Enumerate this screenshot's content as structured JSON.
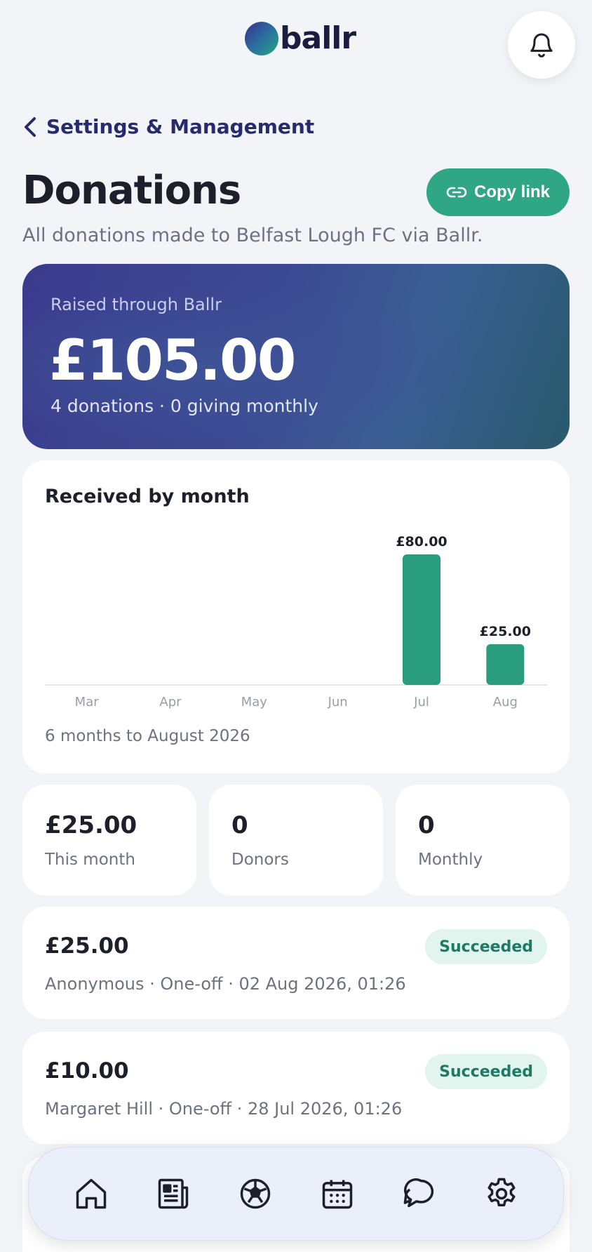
{
  "header": {
    "logo_text": "ballr",
    "logo_icon": "ballr-logo-mark",
    "bell_icon": "bell-icon"
  },
  "back": {
    "label": "Settings & Management"
  },
  "page": {
    "title": "Donations",
    "subtitle": "All donations made to Belfast Lough FC via Ballr.",
    "copy_link_label": "Copy link"
  },
  "hero": {
    "label": "Raised through Ballr",
    "amount": "£105.00",
    "summary": "4 donations · 0 giving monthly"
  },
  "chart": {
    "title": "Received by month",
    "footnote": "6 months to August 2026"
  },
  "chart_data": {
    "type": "bar",
    "title": "Received by month",
    "categories": [
      "Mar",
      "Apr",
      "May",
      "Jun",
      "Jul",
      "Aug"
    ],
    "values": [
      0,
      0,
      0,
      0,
      80,
      25
    ],
    "data_labels": [
      "",
      "",
      "",
      "",
      "£80.00",
      "£25.00"
    ],
    "ylim": [
      0,
      80
    ],
    "grid": false,
    "bar_color": "#2a9d7f"
  },
  "stats": [
    {
      "value": "£25.00",
      "label": "This month"
    },
    {
      "value": "0",
      "label": "Donors"
    },
    {
      "value": "0",
      "label": "Monthly"
    }
  ],
  "donations": [
    {
      "amount": "£25.00",
      "meta": "Anonymous · One-off · 02 Aug 2026, 01:26",
      "status": "Succeeded"
    },
    {
      "amount": "£10.00",
      "meta": "Margaret Hill · One-off · 28 Jul 2026, 01:26",
      "status": "Succeeded"
    }
  ],
  "nav": [
    "home-icon",
    "news-icon",
    "football-icon",
    "calendar-icon",
    "chat-icon",
    "settings-icon"
  ],
  "colors": {
    "accent": "#2fa785",
    "brand_dark": "#272a6d",
    "badge_bg": "#e1f4ee",
    "badge_text": "#1e7a64"
  }
}
